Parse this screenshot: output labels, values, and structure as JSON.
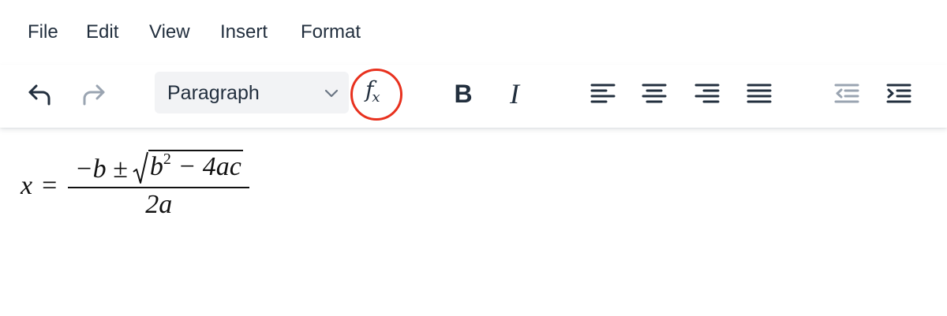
{
  "menubar": {
    "items": [
      {
        "label": "File"
      },
      {
        "label": "Edit"
      },
      {
        "label": "View"
      },
      {
        "label": "Insert"
      },
      {
        "label": "Format"
      }
    ]
  },
  "toolbar": {
    "undo_icon": "undo-icon",
    "redo_icon": "redo-icon",
    "block_format": {
      "selected": "Paragraph",
      "chevron_icon": "chevron-down-icon"
    },
    "formula": {
      "f": "f",
      "x": "x",
      "highlight_color": "#e8311e"
    },
    "bold_label": "B",
    "italic_label": "I",
    "align_icons": [
      "align-left-icon",
      "align-center-icon",
      "align-right-icon",
      "align-justify-icon"
    ],
    "indent_icons": [
      "outdent-icon",
      "indent-icon"
    ],
    "colors": {
      "icon": "#222f3e",
      "disabled_icon": "#9aa4b1",
      "select_bg": "#f2f3f5"
    }
  },
  "content": {
    "equation": {
      "lhs": "x",
      "equals": "=",
      "numerator_prefix": "−b ± ",
      "radicand_base": "b",
      "radicand_exponent": "2",
      "radicand_rest": " − 4ac",
      "denominator": "2a"
    }
  }
}
